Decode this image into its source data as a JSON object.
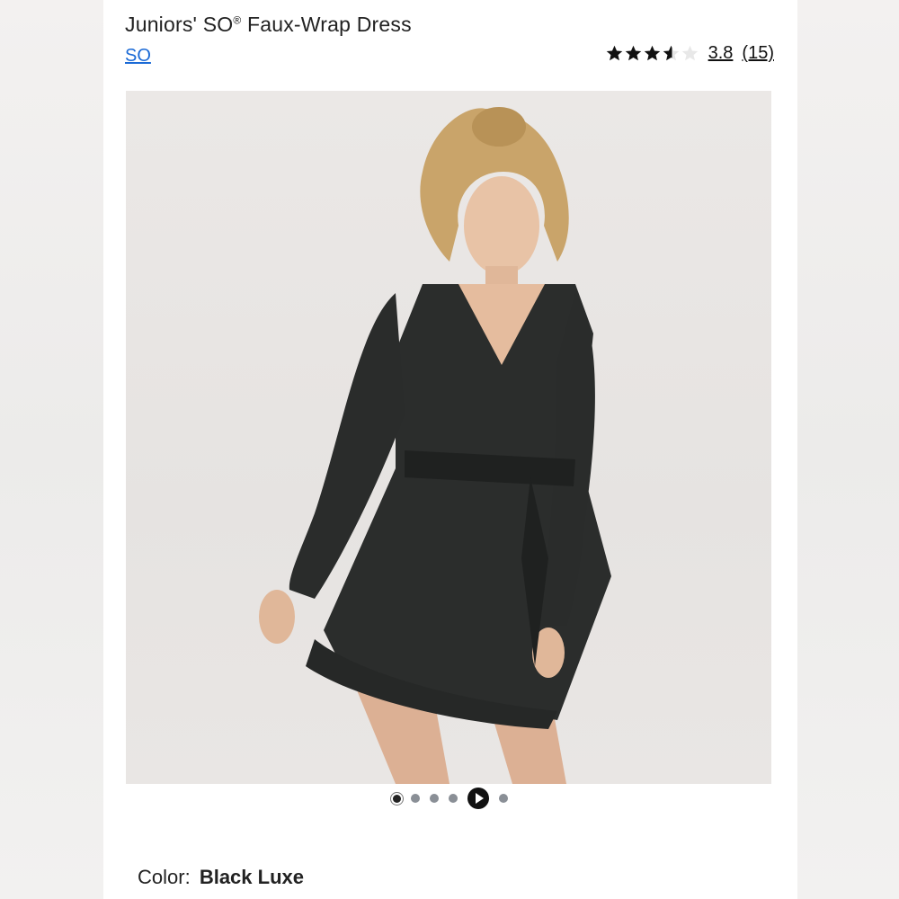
{
  "product": {
    "title_prefix": "Juniors' SO",
    "title_mark": "®",
    "title_suffix": " Faux-Wrap Dress",
    "brand": "SO"
  },
  "rating": {
    "value": "3.8",
    "count": "(15)",
    "stars_filled": 3.5,
    "stars_total": 5
  },
  "gallery": {
    "image_icon": "product-photo",
    "slides_total": 6,
    "active_slide": 1,
    "video_slide": 5
  },
  "color": {
    "label": "Color:",
    "value": "Black Luxe"
  },
  "colors": {
    "link": "#1b6ad6",
    "text": "#222222",
    "dress": "#2b2d2c"
  }
}
